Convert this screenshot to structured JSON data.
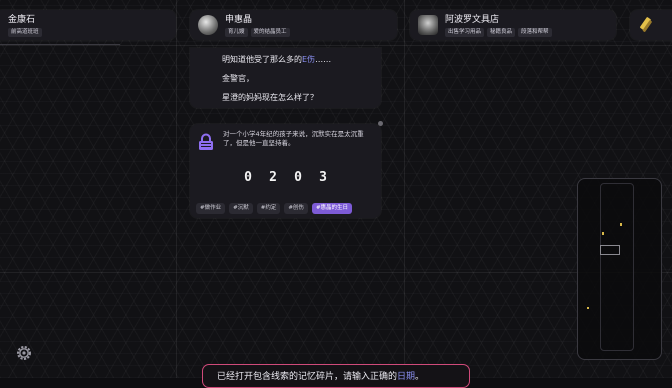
{
  "contacts": [
    {
      "name": "金康石",
      "tags": [
        "前高道班班"
      ]
    },
    {
      "name": "申惠晶",
      "tags": [
        "育儿嫂",
        "爱的结晶员工"
      ]
    },
    {
      "name": "阿波罗文具店",
      "tags": [
        "出售学习用品",
        "秘籍良品",
        "段落和帮帮"
      ]
    }
  ],
  "chat": {
    "line1_pre": "明知道他受了那么多的",
    "line1_hl": "E伤",
    "line1_post": "……",
    "line2": "金警官，",
    "line3": "星澄的妈妈现在怎么样了？"
  },
  "puzzle": {
    "text": "对一个小学4年纪的孩子来说，沉默实在是太沉重了，但是他一直坚持着。",
    "digits": [
      "0",
      "2",
      "0",
      "3"
    ],
    "options": [
      {
        "label": "#做作业",
        "active": false
      },
      {
        "label": "#沉默",
        "active": false
      },
      {
        "label": "#约定",
        "active": false
      },
      {
        "label": "#创伤",
        "active": false
      },
      {
        "label": "#惠晶的生日",
        "active": true
      }
    ]
  },
  "bottom_hint": {
    "pre": "已经打开包含线索的记忆碎片，请输入正确的",
    "hl": "日期",
    "post": "。"
  },
  "colors": {
    "accent": "#7d5bd6",
    "highlight": "#8a8ff0",
    "hint_border": "#d04a7a",
    "lock": "#8e6ef0"
  }
}
